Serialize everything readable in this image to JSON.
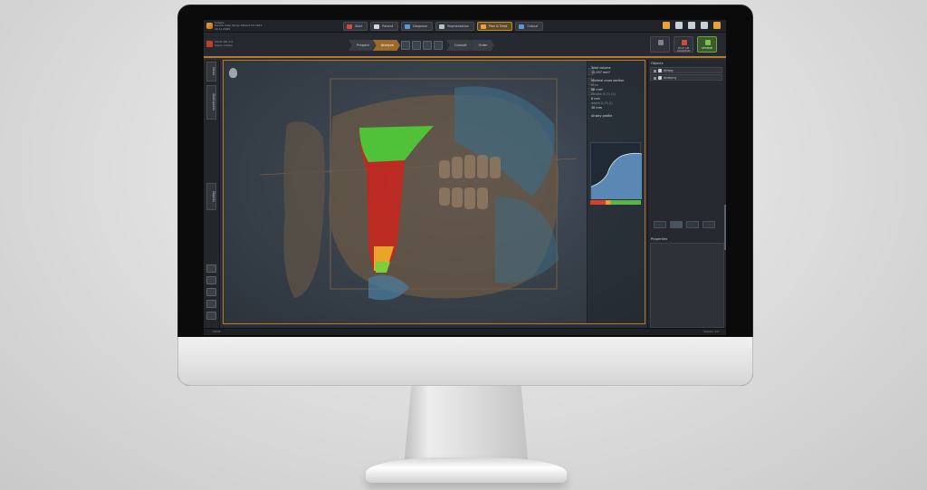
{
  "window": {
    "app_title_lines": [
      "Sidexis",
      "Dental Case Study Patient 04 2015",
      "22.11.1965"
    ]
  },
  "tabs": [
    {
      "label": "Start",
      "color": "#d24a3a",
      "active": false
    },
    {
      "label": "Patient",
      "color": "#d6d6d6",
      "active": false
    },
    {
      "label": "Diagnose",
      "color": "#5b9bd5",
      "active": false
    },
    {
      "label": "Segmentation",
      "color": "#b9c0c6",
      "active": false
    },
    {
      "label": "Plan & Treat",
      "color": "#e8a33a",
      "active": true
    },
    {
      "label": "Output",
      "color": "#5b9bd5",
      "active": false
    }
  ],
  "window_icons": [
    "#e8a33a",
    "#c9d0d6",
    "#c9d0d6",
    "#c9d0d6",
    "#e8a33a"
  ],
  "case": {
    "line1": "SICAT AIR 2.0",
    "line2": "Upper airway"
  },
  "workflow_steps": [
    {
      "label": "Prepare",
      "current": false
    },
    {
      "label": "Analyze",
      "current": true
    },
    {
      "label": "Consult",
      "current": false
    },
    {
      "label": "Order",
      "current": false
    }
  ],
  "right_buttons": [
    {
      "label": "SICAT AIR DIAGNOSIS",
      "color": "#d24a3a",
      "green": false
    },
    {
      "label": "OPTIMIZE",
      "color": "#7cc24a",
      "green": true
    }
  ],
  "left_vtabs": [
    "Views",
    "Workspaces",
    "Objects"
  ],
  "analysis": {
    "total_volume_label": "Total volume",
    "total_volume_value": "12,097 mm³",
    "min_cross_label": "Minimal cross section",
    "min_cross_line1": "Area",
    "min_cross_value": "88 mm²",
    "height_line": "Height: 6.71 (S)",
    "width_label": "Width",
    "width_value": "8 mm",
    "depth_line": "depth (L-R) (I)",
    "depth_value": "36 mm",
    "profile_label": "Airway profile"
  },
  "right_panel": {
    "title": "Objects",
    "objects": [
      "Airway",
      "Anatomy"
    ],
    "properties_title": "Properties"
  },
  "status": {
    "left": "SICAT",
    "right": "Version 2.0"
  }
}
